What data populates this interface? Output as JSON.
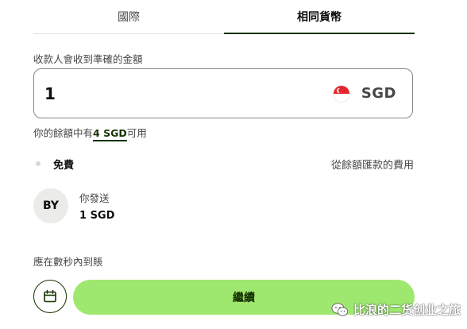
{
  "tabs": [
    {
      "label": "國際",
      "active": false
    },
    {
      "label": "相同貨幣",
      "active": true
    }
  ],
  "recipient_gets": {
    "label": "收款人會收到準確的金額",
    "amount": "1",
    "currency": "SGD",
    "flag_icon": "singapore-flag-icon"
  },
  "balance": {
    "prefix": "你的餘額中有",
    "amount": "4 SGD",
    "suffix": "可用"
  },
  "fee": {
    "label": "免費",
    "note": "從餘額匯款的費用"
  },
  "sender": {
    "avatar_initials": "BY",
    "label": "你發送",
    "value": "1 SGD"
  },
  "arrival": {
    "text": "應在數秒內到賬"
  },
  "actions": {
    "schedule_icon": "calendar-icon",
    "continue_label": "繼續"
  },
  "watermark": {
    "text": "比浪的二货创业之旅"
  },
  "colors": {
    "accent_green": "#9fe870",
    "forest_green": "#163300",
    "text_primary": "#0e0f0c",
    "text_secondary": "#454745",
    "singapore_red": "#e2262b"
  }
}
